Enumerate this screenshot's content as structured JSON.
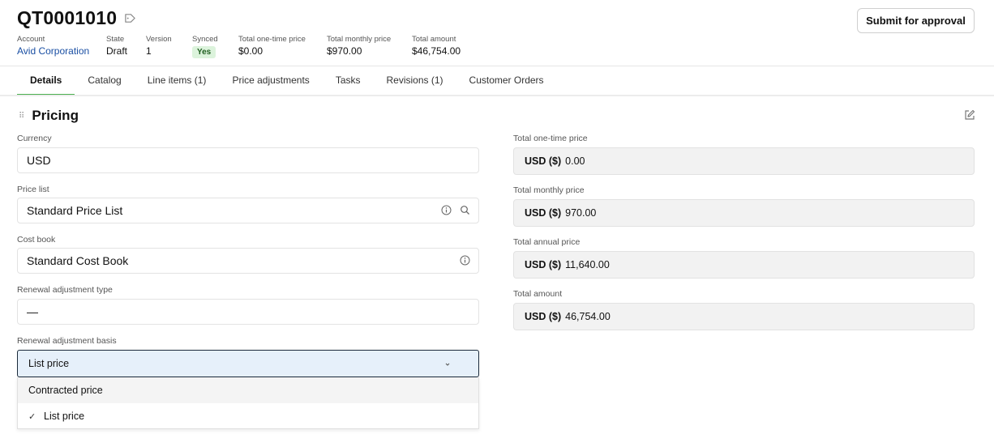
{
  "quote": {
    "title": "QT0001010",
    "submit_label": "Submit for approval"
  },
  "meta": {
    "account": {
      "label": "Account",
      "value": "Avid Corporation"
    },
    "state": {
      "label": "State",
      "value": "Draft"
    },
    "version": {
      "label": "Version",
      "value": "1"
    },
    "synced": {
      "label": "Synced",
      "value": "Yes"
    },
    "one_time": {
      "label": "Total one-time price",
      "value": "$0.00"
    },
    "monthly": {
      "label": "Total monthly price",
      "value": "$970.00"
    },
    "amount": {
      "label": "Total amount",
      "value": "$46,754.00"
    }
  },
  "tabs": [
    {
      "label": "Details",
      "active": true
    },
    {
      "label": "Catalog"
    },
    {
      "label": "Line items (1)"
    },
    {
      "label": "Price adjustments"
    },
    {
      "label": "Tasks"
    },
    {
      "label": "Revisions (1)"
    },
    {
      "label": "Customer Orders"
    }
  ],
  "section": {
    "title": "Pricing"
  },
  "left_fields": {
    "currency": {
      "label": "Currency",
      "value": "USD"
    },
    "price_list": {
      "label": "Price list",
      "value": "Standard Price List"
    },
    "cost_book": {
      "label": "Cost book",
      "value": "Standard Cost Book"
    },
    "renewal_type": {
      "label": "Renewal adjustment type",
      "value": "—"
    },
    "renewal_basis": {
      "label": "Renewal adjustment basis",
      "value": "List price"
    }
  },
  "dropdown_options": [
    {
      "label": "Contracted price",
      "selected": false
    },
    {
      "label": "List price",
      "selected": true
    }
  ],
  "right_fields": {
    "one_time": {
      "label": "Total one-time price",
      "currency": "USD ($)",
      "value": "0.00"
    },
    "monthly": {
      "label": "Total monthly price",
      "currency": "USD ($)",
      "value": "970.00"
    },
    "annual": {
      "label": "Total annual price",
      "currency": "USD ($)",
      "value": "11,640.00"
    },
    "amount": {
      "label": "Total amount",
      "currency": "USD ($)",
      "value": "46,754.00"
    }
  },
  "colors": {
    "active_tab_underline": "#4caf50",
    "synced_badge_bg": "#dcf3dc",
    "account_link": "#1a4fa3",
    "select_bg": "#e6f0fa"
  }
}
